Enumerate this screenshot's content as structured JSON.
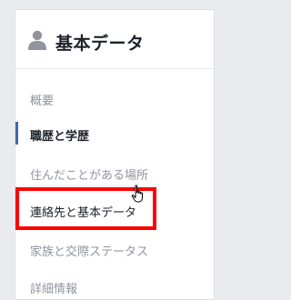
{
  "header": {
    "title": "基本データ",
    "icon": "person-icon"
  },
  "nav": {
    "items": [
      {
        "label": "概要"
      },
      {
        "label": "職歴と学歴"
      },
      {
        "label": "住んだことがある場所"
      },
      {
        "label": "連絡先と基本データ"
      },
      {
        "label": "家族と交際ステータス"
      },
      {
        "label": "詳細情報"
      }
    ]
  },
  "colors": {
    "accent": "#4267b2",
    "highlight": "#ff0000"
  }
}
